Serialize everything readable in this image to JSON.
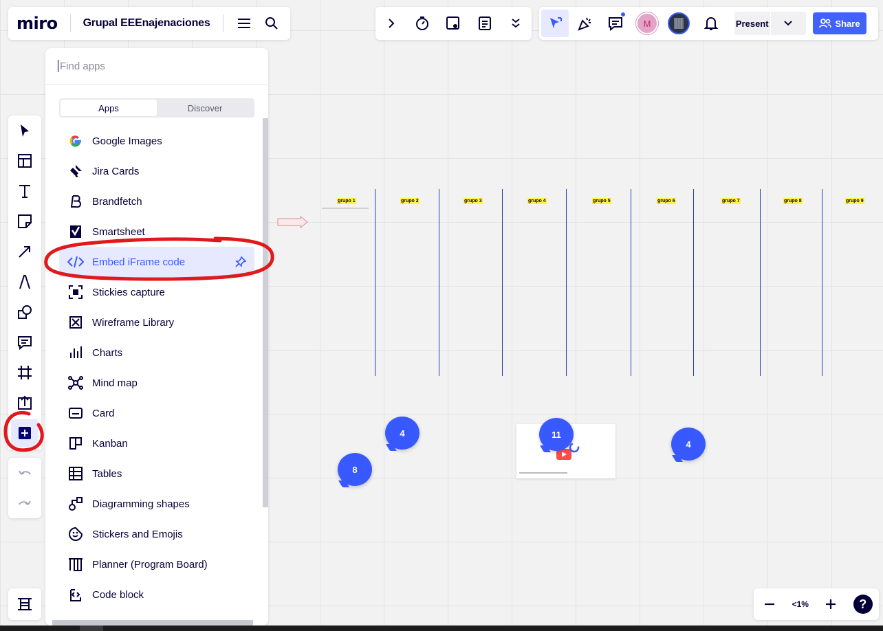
{
  "header": {
    "logo": "miro",
    "board_title": "Grupal EEEnajenaciones",
    "present_label": "Present",
    "share_label": "Share",
    "avatar_initial": "M"
  },
  "apps_panel": {
    "search_placeholder": "Find apps",
    "tabs": [
      "Apps",
      "Discover"
    ],
    "items": [
      {
        "label": "Google Images",
        "icon": "google-icon"
      },
      {
        "label": "Jira Cards",
        "icon": "jira-icon"
      },
      {
        "label": "Brandfetch",
        "icon": "brandfetch-icon"
      },
      {
        "label": "Smartsheet",
        "icon": "smartsheet-icon"
      },
      {
        "label": "Embed iFrame code",
        "icon": "code-icon"
      },
      {
        "label": "Stickies capture",
        "icon": "capture-icon"
      },
      {
        "label": "Wireframe Library",
        "icon": "wireframe-icon"
      },
      {
        "label": "Charts",
        "icon": "chart-icon"
      },
      {
        "label": "Mind map",
        "icon": "mindmap-icon"
      },
      {
        "label": "Card",
        "icon": "card-icon"
      },
      {
        "label": "Kanban",
        "icon": "kanban-icon"
      },
      {
        "label": "Tables",
        "icon": "table-icon"
      },
      {
        "label": "Diagramming shapes",
        "icon": "shapes-icon"
      },
      {
        "label": "Stickers and Emojis",
        "icon": "emoji-icon"
      },
      {
        "label": "Planner (Program Board)",
        "icon": "planner-icon"
      },
      {
        "label": "Code block",
        "icon": "codeblock-icon"
      }
    ]
  },
  "board": {
    "group_labels": [
      "grupo 1",
      "grupo 2",
      "grupo 3",
      "grupo 4",
      "grupo 5",
      "grupo 6",
      "grupo 7",
      "grupo 8",
      "grupo 9"
    ],
    "comment_counts": [
      "4",
      "11",
      "4",
      "8"
    ]
  },
  "zoom": {
    "value": "<1%",
    "help": "?"
  },
  "colors": {
    "accent": "#4262ff",
    "selected_bg": "#e6e9ff",
    "annotation": "#e0191c"
  }
}
